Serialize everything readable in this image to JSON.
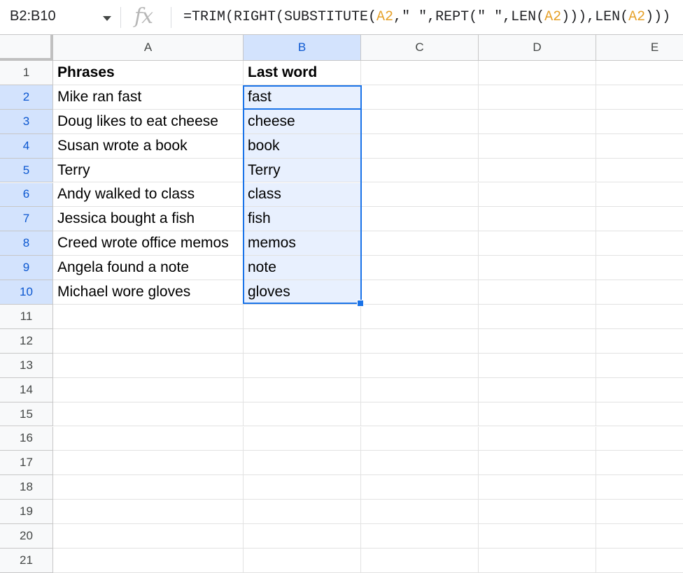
{
  "formula_bar": {
    "name_box": "B2:B10",
    "fx_label": "fx",
    "formula_parts": [
      {
        "text": "=TRIM(RIGHT(SUBSTITUTE(",
        "ref": false
      },
      {
        "text": "A2",
        "ref": true
      },
      {
        "text": ",\" \",REPT(\" \",LEN(",
        "ref": false
      },
      {
        "text": "A2",
        "ref": true
      },
      {
        "text": "))),LEN(",
        "ref": false
      },
      {
        "text": "A2",
        "ref": true
      },
      {
        "text": ")))",
        "ref": false
      }
    ]
  },
  "columns": [
    "A",
    "B",
    "C",
    "D",
    "E"
  ],
  "selected_column": "B",
  "rows": [
    "1",
    "2",
    "3",
    "4",
    "5",
    "6",
    "7",
    "8",
    "9",
    "10",
    "11",
    "12",
    "13",
    "14",
    "15",
    "16",
    "17",
    "18",
    "19",
    "20",
    "21"
  ],
  "selected_rows": [
    "2",
    "3",
    "4",
    "5",
    "6",
    "7",
    "8",
    "9",
    "10"
  ],
  "headers": {
    "a": "Phrases",
    "b": "Last word"
  },
  "data": [
    {
      "phrase": "Mike ran fast",
      "last_word": "fast"
    },
    {
      "phrase": "Doug likes to eat cheese",
      "last_word": "cheese"
    },
    {
      "phrase": "Susan wrote a book",
      "last_word": "book"
    },
    {
      "phrase": "Terry",
      "last_word": "Terry"
    },
    {
      "phrase": "Andy walked to class",
      "last_word": "class"
    },
    {
      "phrase": "Jessica bought a fish",
      "last_word": "fish"
    },
    {
      "phrase": "Creed wrote office memos",
      "last_word": "memos"
    },
    {
      "phrase": "Angela found a note",
      "last_word": "note"
    },
    {
      "phrase": "Michael wore gloves",
      "last_word": "gloves"
    }
  ],
  "colors": {
    "selection": "#1a73e8",
    "range_fill": "#e8f0fe",
    "cell_ref": "#e6a12a"
  }
}
